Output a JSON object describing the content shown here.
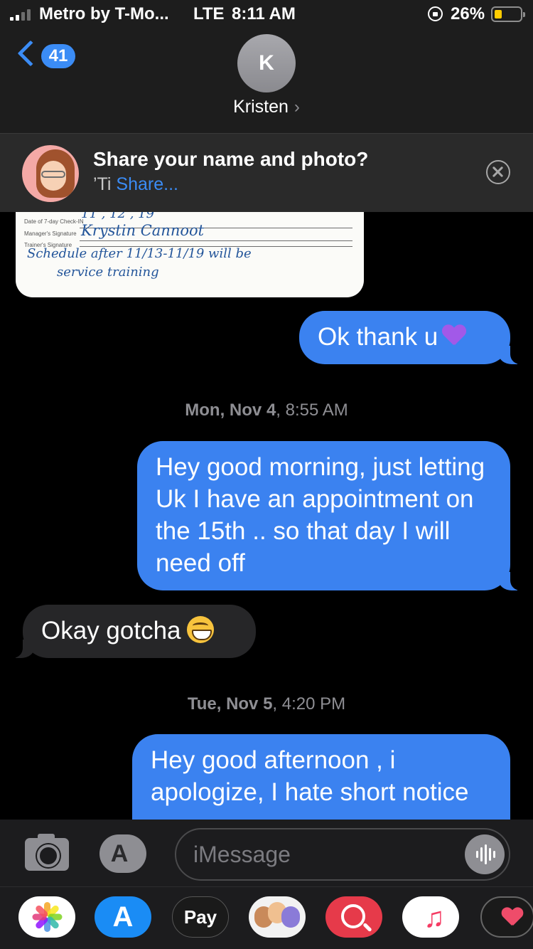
{
  "status_bar": {
    "carrier": "Metro by T-Mo...",
    "network": "LTE",
    "time": "8:11 AM",
    "battery_percent": "26%",
    "battery_level": 0.26,
    "battery_color": "#ffcc00",
    "signal_bars": 2
  },
  "header": {
    "back_count": "41",
    "avatar_initial": "K",
    "contact_name": "Kristen",
    "contact_chevron": "›"
  },
  "share_banner": {
    "title": "Share your name and photo?",
    "subtitle_prefix": "’Ti",
    "subtitle_link": "Share..."
  },
  "photo_attachment": {
    "date_label": "Date of 7-day Check-IN",
    "date_value": "11 , 12 , 19",
    "manager_label": "Manager's Signature",
    "manager_signature": "Krystin Cannoot",
    "trainer_label": "Trainer's Signature",
    "note_line1": "Schedule after 11/13-11/19 will be",
    "note_line2": "service training"
  },
  "messages": [
    {
      "direction": "sent",
      "text": "Ok thank u",
      "emoji": "purple-heart"
    },
    {
      "direction": "sent",
      "text": "Hey good morning, just letting Uk I have an appointment on the 15th .. so that day I will need off"
    },
    {
      "direction": "received",
      "text": "Okay gotcha",
      "emoji": "grinning-face"
    },
    {
      "direction": "sent",
      "text": "Hey good afternoon , i apologize, I hate short notice"
    }
  ],
  "timestamps": [
    {
      "day": "Mon, Nov 4",
      "time": "8:55 AM"
    },
    {
      "day": "Tue, Nov 5",
      "time": "4:20 PM"
    }
  ],
  "input_bar": {
    "placeholder": "iMessage"
  },
  "app_drawer": [
    {
      "name": "photos",
      "icon": "photos-icon"
    },
    {
      "name": "app-store",
      "icon": "app-store-icon"
    },
    {
      "name": "apple-pay",
      "label": "Pay",
      "icon": "apple-pay-icon"
    },
    {
      "name": "memoji",
      "icon": "memoji-icon"
    },
    {
      "name": "search-images",
      "icon": "globe-search-icon"
    },
    {
      "name": "music",
      "icon": "music-note-icon"
    },
    {
      "name": "digital-touch",
      "icon": "heart-icon"
    }
  ],
  "colors": {
    "sent_bubble": "#3b82f0",
    "received_bubble": "#262628",
    "accent": "#3b8cf5"
  }
}
